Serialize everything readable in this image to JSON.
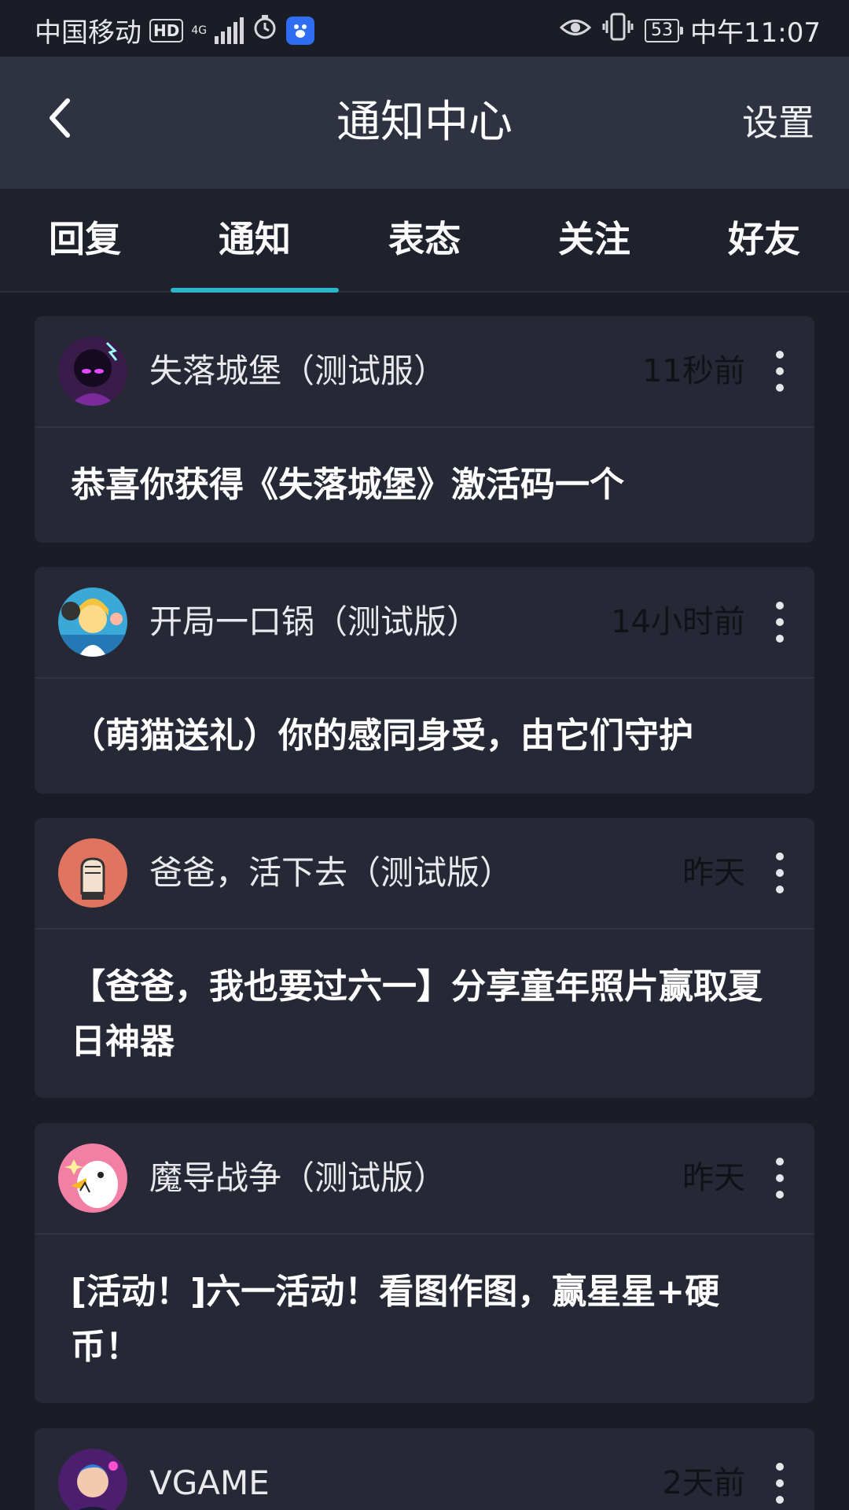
{
  "status_bar": {
    "carrier": "中国移动",
    "hd_badge": "HD",
    "network": "4G",
    "battery_level": "53",
    "time": "中午11:07",
    "icons": [
      "hd-icon",
      "signal-icon",
      "alarm-icon",
      "baidu-icon",
      "eye-icon",
      "vibrate-icon",
      "battery-icon"
    ]
  },
  "header": {
    "title": "通知中心",
    "back_icon": "chevron-left-icon",
    "settings_label": "设置"
  },
  "tabs": [
    {
      "label": "回复"
    },
    {
      "label": "通知",
      "active": true
    },
    {
      "label": "表态"
    },
    {
      "label": "关注"
    },
    {
      "label": "好友"
    }
  ],
  "accent_color": "#2bb6cc",
  "notifications": [
    {
      "sender": "失落城堡（测试服）",
      "time": "11秒前",
      "message": "恭喜你获得《失落城堡》激活码一个"
    },
    {
      "sender": "开局一口锅（测试版）",
      "time": "14小时前",
      "message": "（萌猫送礼）你的感同身受，由它们守护"
    },
    {
      "sender": "爸爸，活下去（测试版）",
      "time": "昨天",
      "message": "【爸爸，我也要过六一】分享童年照片赢取夏日神器"
    },
    {
      "sender": "魔导战争（测试版）",
      "time": "昨天",
      "message": "[活动！]六一活动！看图作图，赢星星+硬币！"
    },
    {
      "sender": "VGAME",
      "time": "2天前",
      "message": ""
    }
  ]
}
